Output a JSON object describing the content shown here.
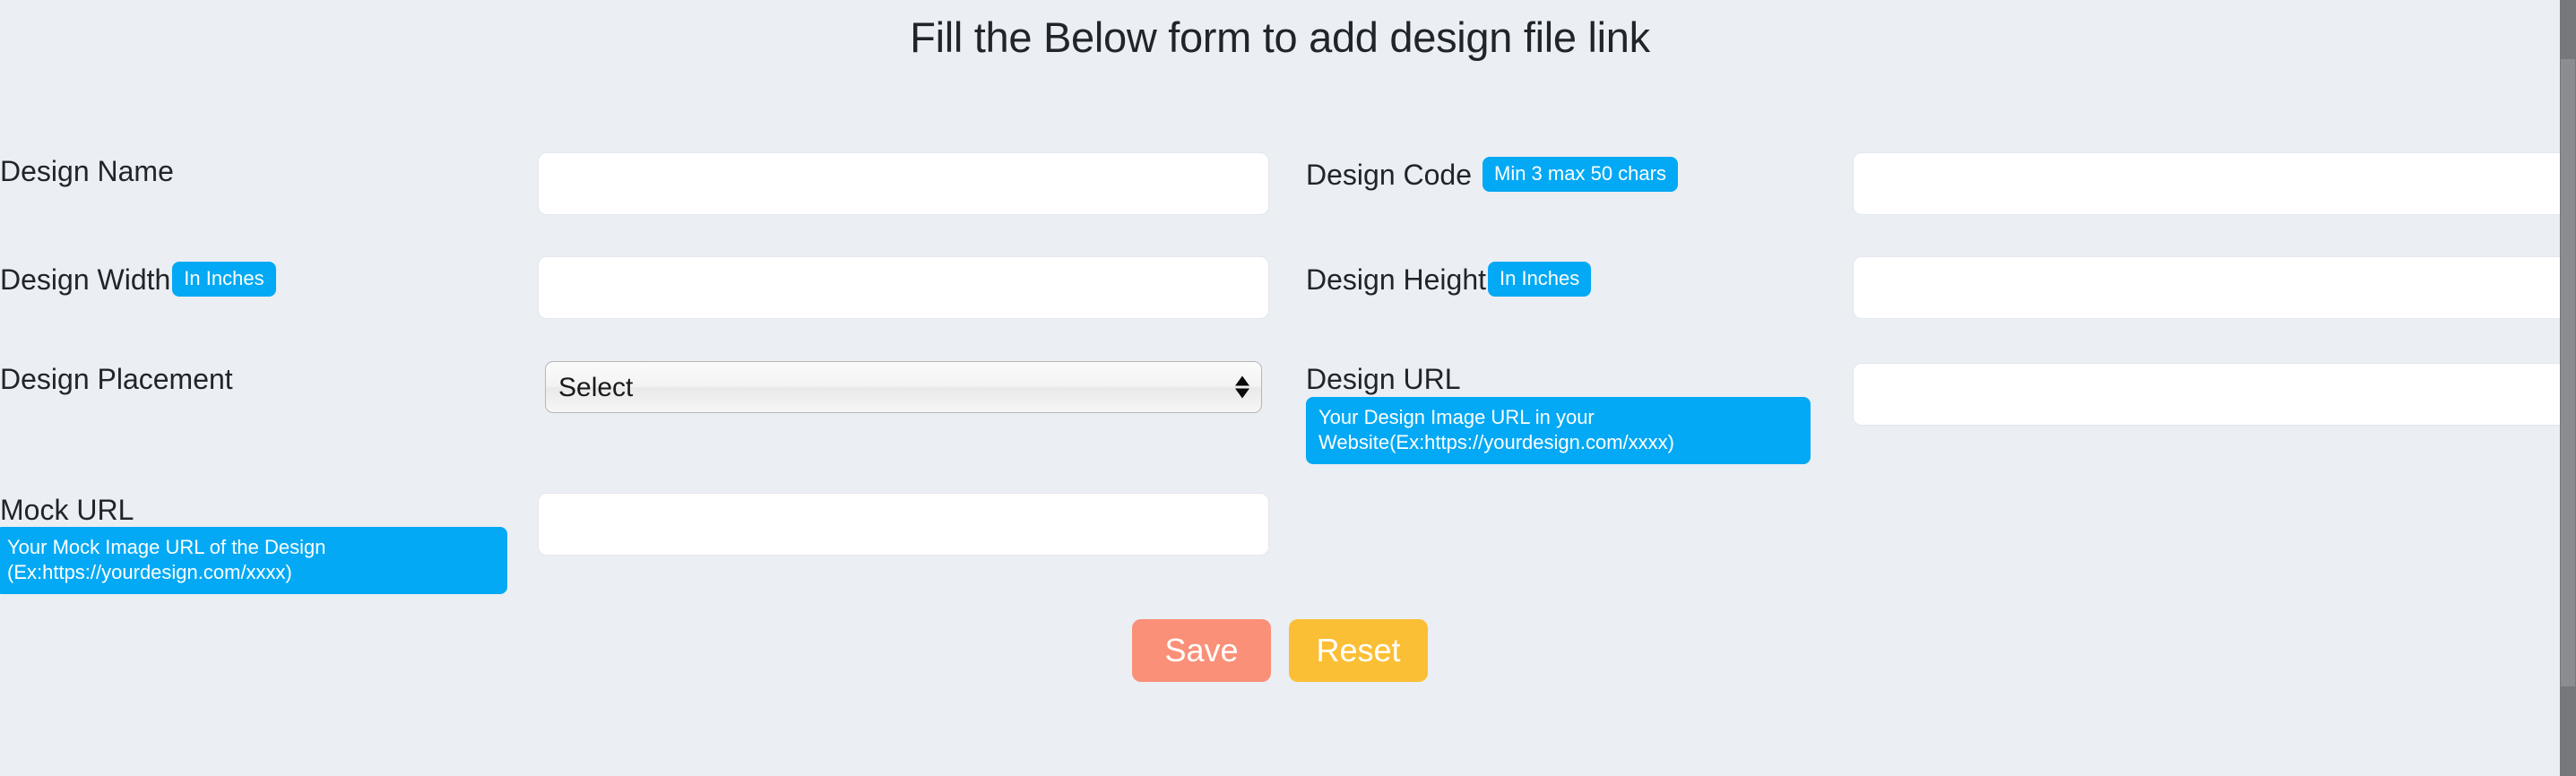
{
  "page": {
    "title": "Fill the Below form to add design file link",
    "background_color": "#ebeef3",
    "accent_color": "#03a9f4"
  },
  "form": {
    "fields": [
      {
        "id": "design-name",
        "label": "Design Name",
        "badge": "",
        "hint": "",
        "value": "",
        "placeholder": "",
        "type": "text",
        "column": "left"
      },
      {
        "id": "design-code",
        "label": "Design Code",
        "badge": "Min 3 max 50 chars",
        "hint": "",
        "value": "",
        "placeholder": "",
        "type": "text",
        "column": "right"
      },
      {
        "id": "design-width",
        "label": "Design Width",
        "badge": "In Inches",
        "hint": "",
        "value": "",
        "placeholder": "",
        "type": "text",
        "column": "left"
      },
      {
        "id": "design-height",
        "label": "Design Height",
        "badge": "In Inches",
        "hint": "",
        "value": "",
        "placeholder": "",
        "type": "text",
        "column": "right"
      },
      {
        "id": "design-placement",
        "label": "Design Placement",
        "badge": "",
        "hint": "",
        "value": "Select",
        "placeholder": "",
        "type": "select",
        "column": "left",
        "options": [
          "Select"
        ]
      },
      {
        "id": "design-url",
        "label": "Design URL",
        "badge": "",
        "hint": "Your Design Image URL in your Website(Ex:https://yourdesign.com/xxxx)",
        "value": "",
        "placeholder": "",
        "type": "text",
        "column": "right"
      },
      {
        "id": "mock-url",
        "label": "Mock URL",
        "badge": "",
        "hint": "Your Mock Image URL of the Design (Ex:https://yourdesign.com/xxxx)",
        "value": "",
        "placeholder": "",
        "type": "text",
        "column": "left"
      }
    ]
  },
  "actions": {
    "save_label": "Save",
    "reset_label": "Reset",
    "save_color": "#fa9078",
    "reset_color": "#fbbf35"
  },
  "scrollbar": {
    "orientation": "vertical",
    "position": "right"
  }
}
